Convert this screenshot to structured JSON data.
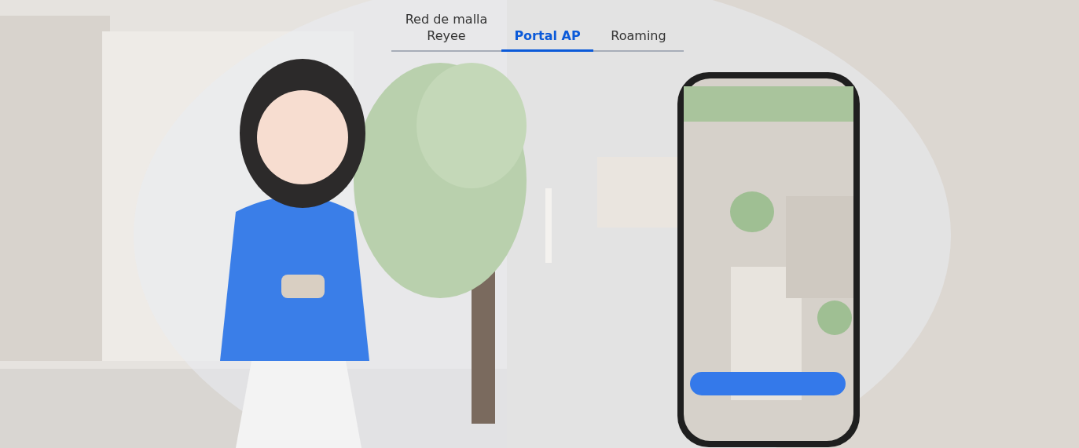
{
  "tabs": [
    {
      "label": "Red de malla Reyee",
      "selected": false
    },
    {
      "label": "Portal AP",
      "selected": true
    },
    {
      "label": "Roaming",
      "selected": false
    }
  ]
}
